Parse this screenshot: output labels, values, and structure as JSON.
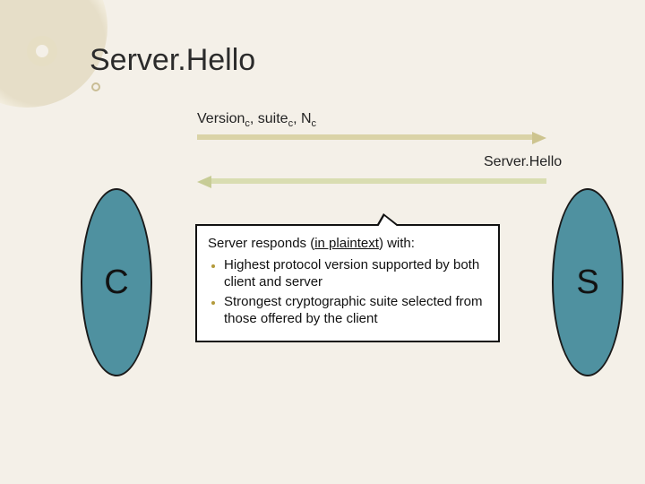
{
  "title": "Server.Hello",
  "nodes": {
    "client_label": "C",
    "server_label": "S"
  },
  "arrows": {
    "client_hello_label_html": "Version<sub>c</sub>, suite<sub>c</sub>, N<sub>c</sub>",
    "server_hello_label": "Server.Hello"
  },
  "infobox": {
    "lead_prefix": "Server responds (",
    "lead_underlined": "in plaintext",
    "lead_suffix": ") with:",
    "bullets": [
      "Highest protocol version supported by both client and server",
      "Strongest cryptographic suite selected from those offered by the client"
    ]
  }
}
